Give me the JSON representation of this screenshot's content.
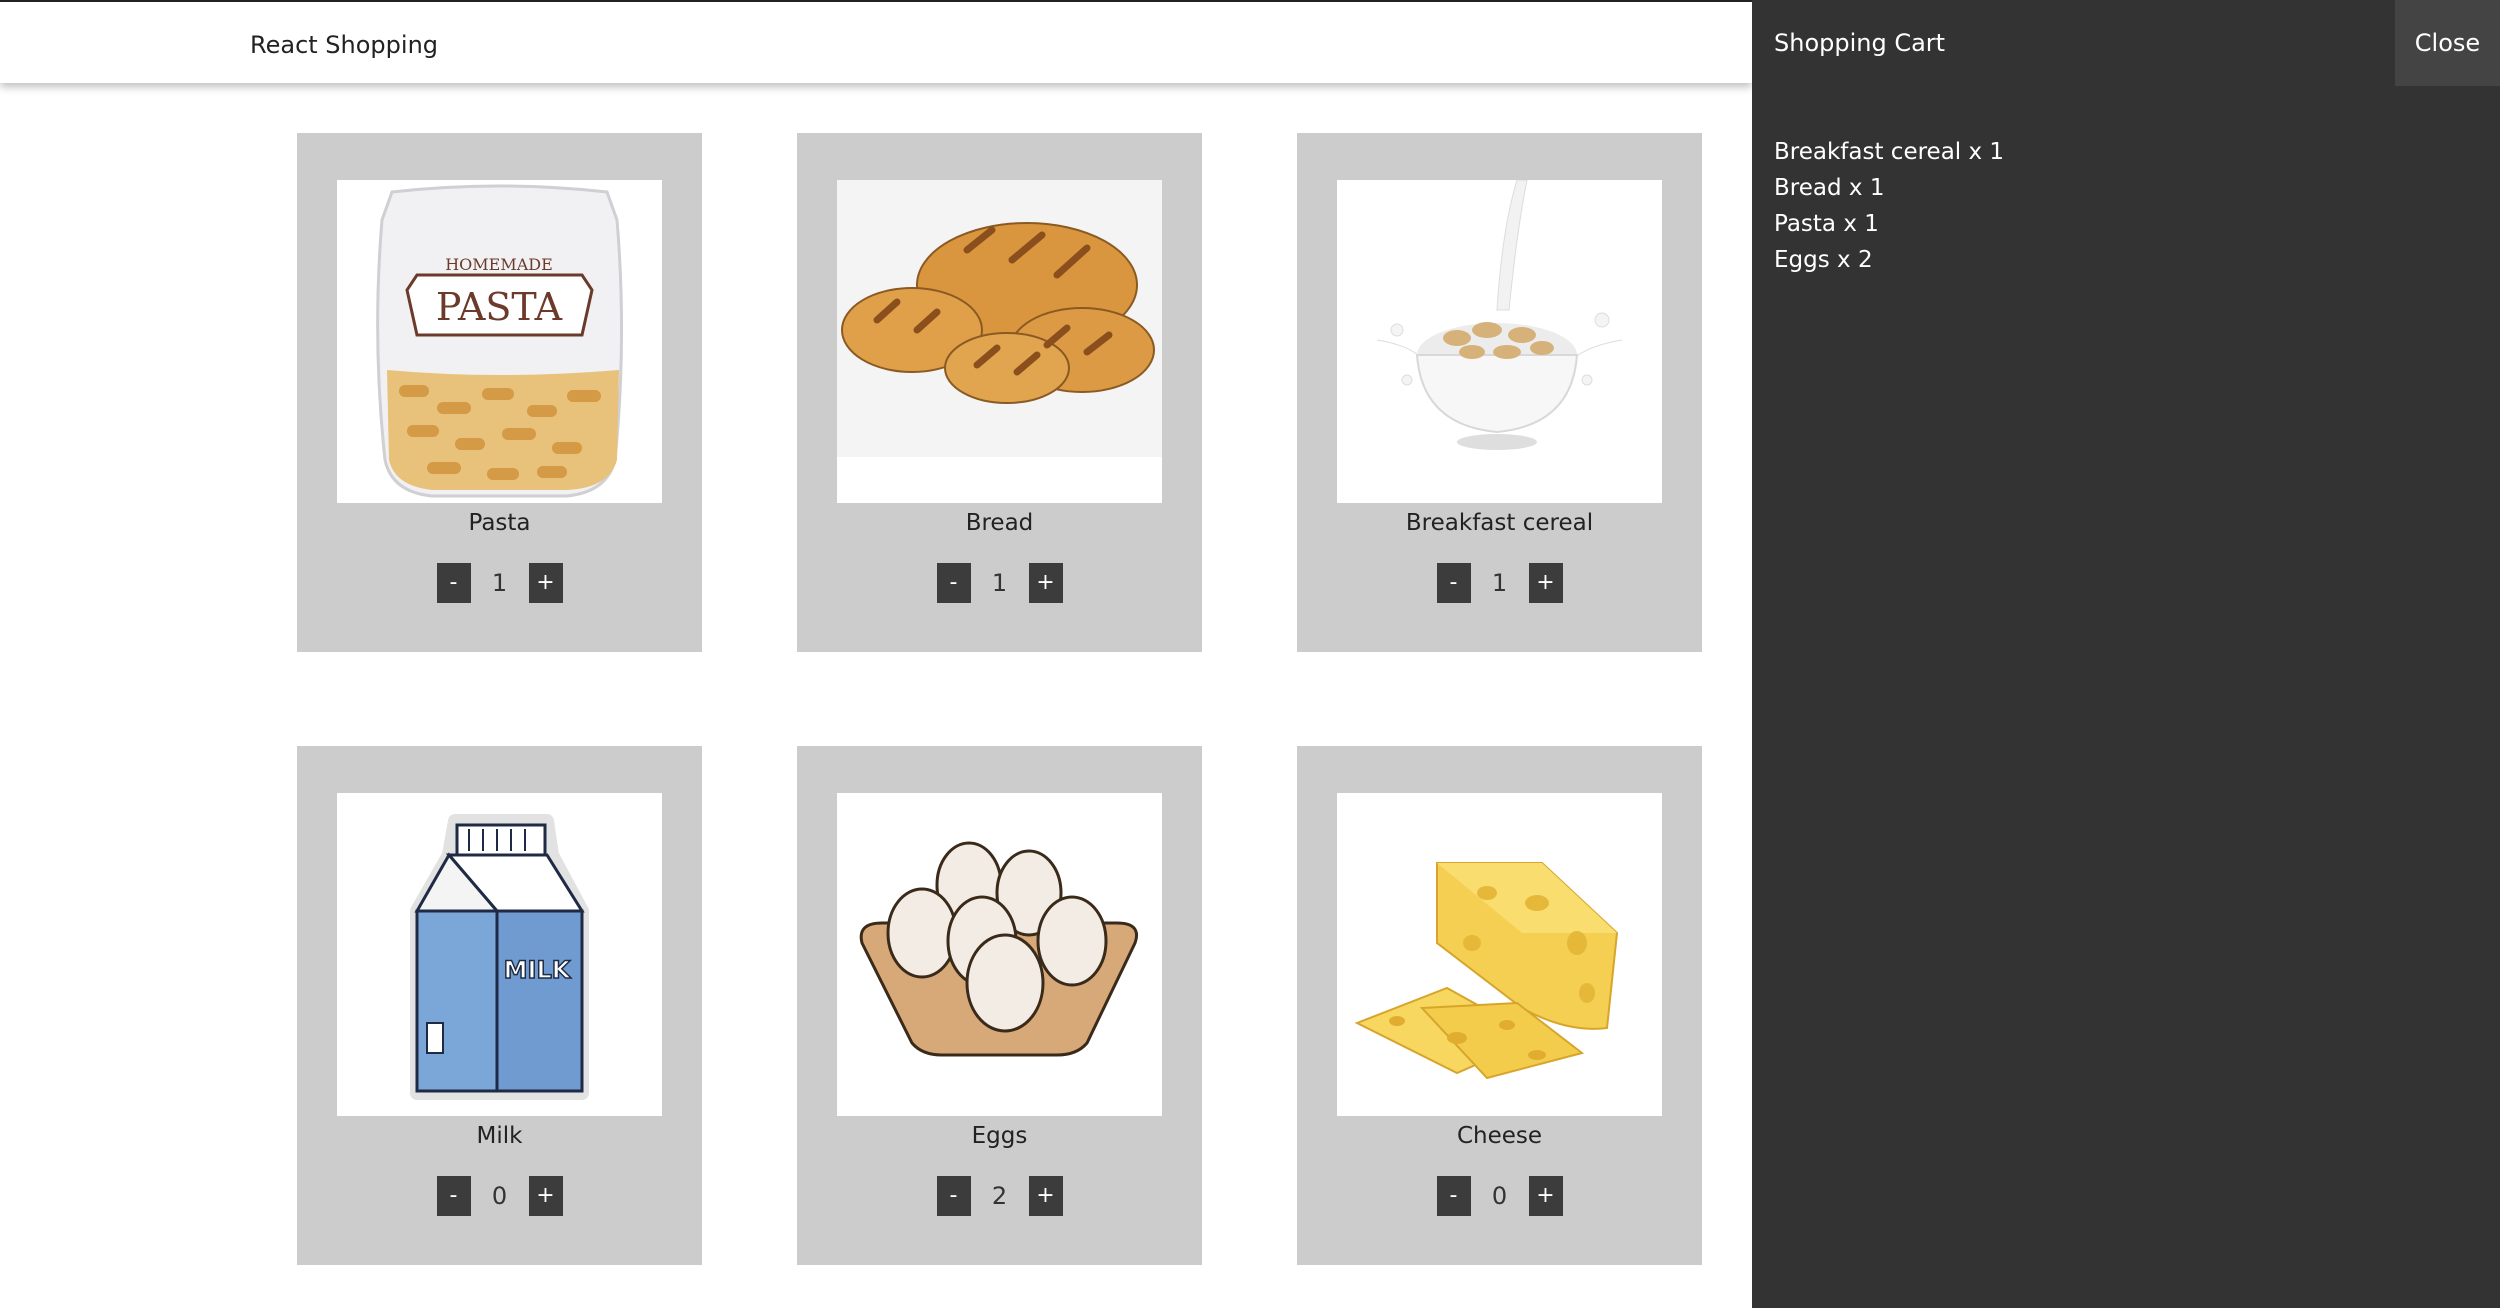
{
  "navbar": {
    "brand": "React Shopping"
  },
  "products": [
    {
      "name": "Pasta",
      "quantity": "1",
      "minus_label": "-",
      "plus_label": "+",
      "icon": "pasta-bag-image"
    },
    {
      "name": "Bread",
      "quantity": "1",
      "minus_label": "-",
      "plus_label": "+",
      "icon": "bread-loaves-image"
    },
    {
      "name": "Breakfast cereal",
      "quantity": "1",
      "minus_label": "-",
      "plus_label": "+",
      "icon": "cereal-bowl-image"
    },
    {
      "name": "Milk",
      "quantity": "0",
      "minus_label": "-",
      "plus_label": "+",
      "icon": "milk-carton-image"
    },
    {
      "name": "Eggs",
      "quantity": "2",
      "minus_label": "-",
      "plus_label": "+",
      "icon": "eggs-carton-image"
    },
    {
      "name": "Cheese",
      "quantity": "0",
      "minus_label": "-",
      "plus_label": "+",
      "icon": "cheese-wedge-image"
    }
  ],
  "cart": {
    "title": "Shopping Cart",
    "close_label": "Close",
    "items": [
      {
        "name": "Breakfast cereal",
        "quantity": "1"
      },
      {
        "name": "Bread",
        "quantity": "1"
      },
      {
        "name": "Pasta",
        "quantity": "1"
      },
      {
        "name": "Eggs",
        "quantity": "2"
      }
    ]
  },
  "colors": {
    "card_background": "#cccccc",
    "button_background": "#3c3c3c",
    "cart_background": "#333333",
    "close_button_background": "#444444"
  }
}
